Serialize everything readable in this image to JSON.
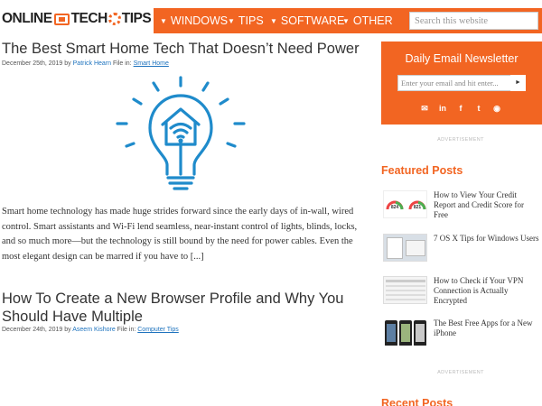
{
  "header": {
    "logo_text_left": "ONLINE",
    "logo_text_mid": "TECH",
    "logo_text_right": "TIPS",
    "nav": [
      "WINDOWS",
      "TIPS",
      "SOFTWARE",
      "OTHER"
    ],
    "nav_caret": "▼",
    "search_placeholder": "Search this website"
  },
  "articles": [
    {
      "title": "The Best Smart Home Tech That Doesn’t Need Power",
      "date": "December 25th, 2019",
      "by": "by",
      "author": "Patrick Hearn",
      "file_in": "File in:",
      "category": "Smart Home",
      "excerpt": "Smart home technology has made huge strides forward since the early days of in-wall, wired control. Smart assistants and Wi-Fi lend seamless, near-instant control of lights, blinds, locks, and so much more—but the technology is still bound by the need for power cables.  Even the most elegant design can be marred if you have to [...]"
    },
    {
      "title_line1": "How To Create a New Browser Profile and Why You",
      "title_line2": "Should Have Multiple",
      "date": "December 24th, 2019",
      "by": "by",
      "author": "Aseem Kishore",
      "file_in": "File in:",
      "category": "Computer Tips"
    }
  ],
  "sidebar": {
    "newsletter_title": "Daily Email Newsletter",
    "email_placeholder": "Enter your email and hit enter...",
    "go_symbol": "►",
    "social": [
      "✉",
      "in",
      "f",
      "t",
      "◉"
    ],
    "advertisement": "ADVERTISEMENT",
    "featured_heading": "Featured Posts",
    "featured": [
      {
        "title": "How to View Your Credit Report and Credit Score for Free",
        "scores": [
          "824",
          "821"
        ]
      },
      {
        "title": "7 OS X Tips for Windows Users"
      },
      {
        "title": "How to Check if Your VPN Connection is Actually Encrypted"
      },
      {
        "title": "The Best Free Apps for a New iPhone"
      }
    ],
    "recent_heading": "Recent Posts"
  },
  "colors": {
    "accent": "#f26522",
    "link": "#1e73be",
    "illustration": "#1f8bcb"
  }
}
